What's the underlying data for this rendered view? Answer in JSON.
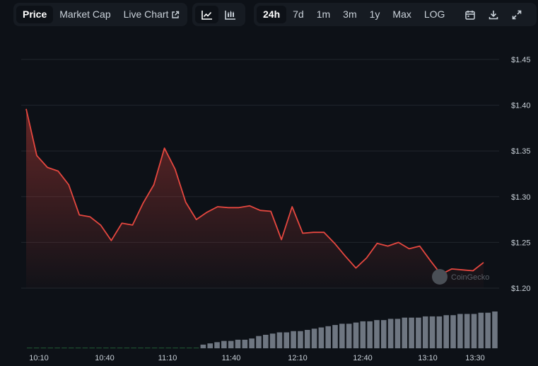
{
  "tabs": {
    "price": "Price",
    "market_cap": "Market Cap",
    "live_chart": "Live Chart"
  },
  "chart_type_icons": [
    "line-chart-icon",
    "candlestick-chart-icon"
  ],
  "ranges": [
    "24h",
    "7d",
    "1m",
    "3m",
    "1y",
    "Max",
    "LOG"
  ],
  "active_range": "24h",
  "tool_icons": [
    "calendar-icon",
    "download-icon",
    "expand-icon"
  ],
  "watermark": "CoinGecko",
  "colors": {
    "background": "#0d1117",
    "line": "#e5473f",
    "volume": "#6e7681",
    "volume_green": "#1f5a33",
    "grid": "#21262d"
  },
  "chart_data": {
    "type": "area",
    "title": "",
    "y_ticks": [
      "$1.45",
      "$1.40",
      "$1.35",
      "$1.30",
      "$1.25",
      "$1.20"
    ],
    "y_tick_values": [
      1.45,
      1.4,
      1.35,
      1.3,
      1.25,
      1.2
    ],
    "ylim": [
      1.2,
      1.45
    ],
    "x_ticks": [
      "10:10",
      "10:40",
      "11:10",
      "11:40",
      "12:10",
      "12:40",
      "13:10",
      "13:30"
    ],
    "x_tick_positions": [
      0,
      30,
      60,
      90,
      120,
      150,
      180,
      200
    ],
    "xlim": [
      -2,
      220
    ],
    "price_minutes": [
      0,
      5,
      10,
      15,
      20,
      25,
      30,
      35,
      40,
      45,
      50,
      55,
      60,
      65,
      70,
      75,
      80,
      85,
      90,
      95,
      100,
      105,
      110,
      115,
      120,
      125,
      130,
      135,
      140,
      145,
      150,
      155,
      160,
      165,
      170,
      175,
      180,
      185,
      190,
      195,
      200,
      205,
      210,
      215
    ],
    "price_values": [
      1.396,
      1.345,
      1.332,
      1.328,
      1.313,
      1.28,
      1.278,
      1.269,
      1.252,
      1.271,
      1.269,
      1.293,
      1.313,
      1.353,
      1.33,
      1.294,
      1.275,
      1.283,
      1.289,
      1.288,
      1.288,
      1.29,
      1.285,
      1.284,
      1.253,
      1.289,
      1.26,
      1.261,
      1.261,
      1.249,
      1.235,
      1.222,
      1.233,
      1.249,
      1.246,
      1.25,
      1.243,
      1.246,
      1.23,
      1.215,
      1.221,
      1.22,
      1.219,
      1.228
    ],
    "volume_values": [
      0,
      0,
      0,
      0,
      0,
      0,
      0,
      0,
      0,
      0,
      0,
      0,
      0,
      0,
      0,
      0,
      0,
      0,
      0,
      0,
      0,
      0,
      0,
      0,
      0,
      0.3,
      0.4,
      0.5,
      0.6,
      0.6,
      0.7,
      0.7,
      0.8,
      1.0,
      1.1,
      1.2,
      1.3,
      1.3,
      1.4,
      1.4,
      1.5,
      1.6,
      1.7,
      1.8,
      1.9,
      2.0,
      2.0,
      2.1,
      2.2,
      2.2,
      2.3,
      2.3,
      2.4,
      2.4,
      2.5,
      2.5,
      2.5,
      2.6,
      2.6,
      2.6,
      2.7,
      2.7,
      2.8,
      2.8,
      2.8,
      2.9,
      2.9,
      3.0
    ]
  }
}
